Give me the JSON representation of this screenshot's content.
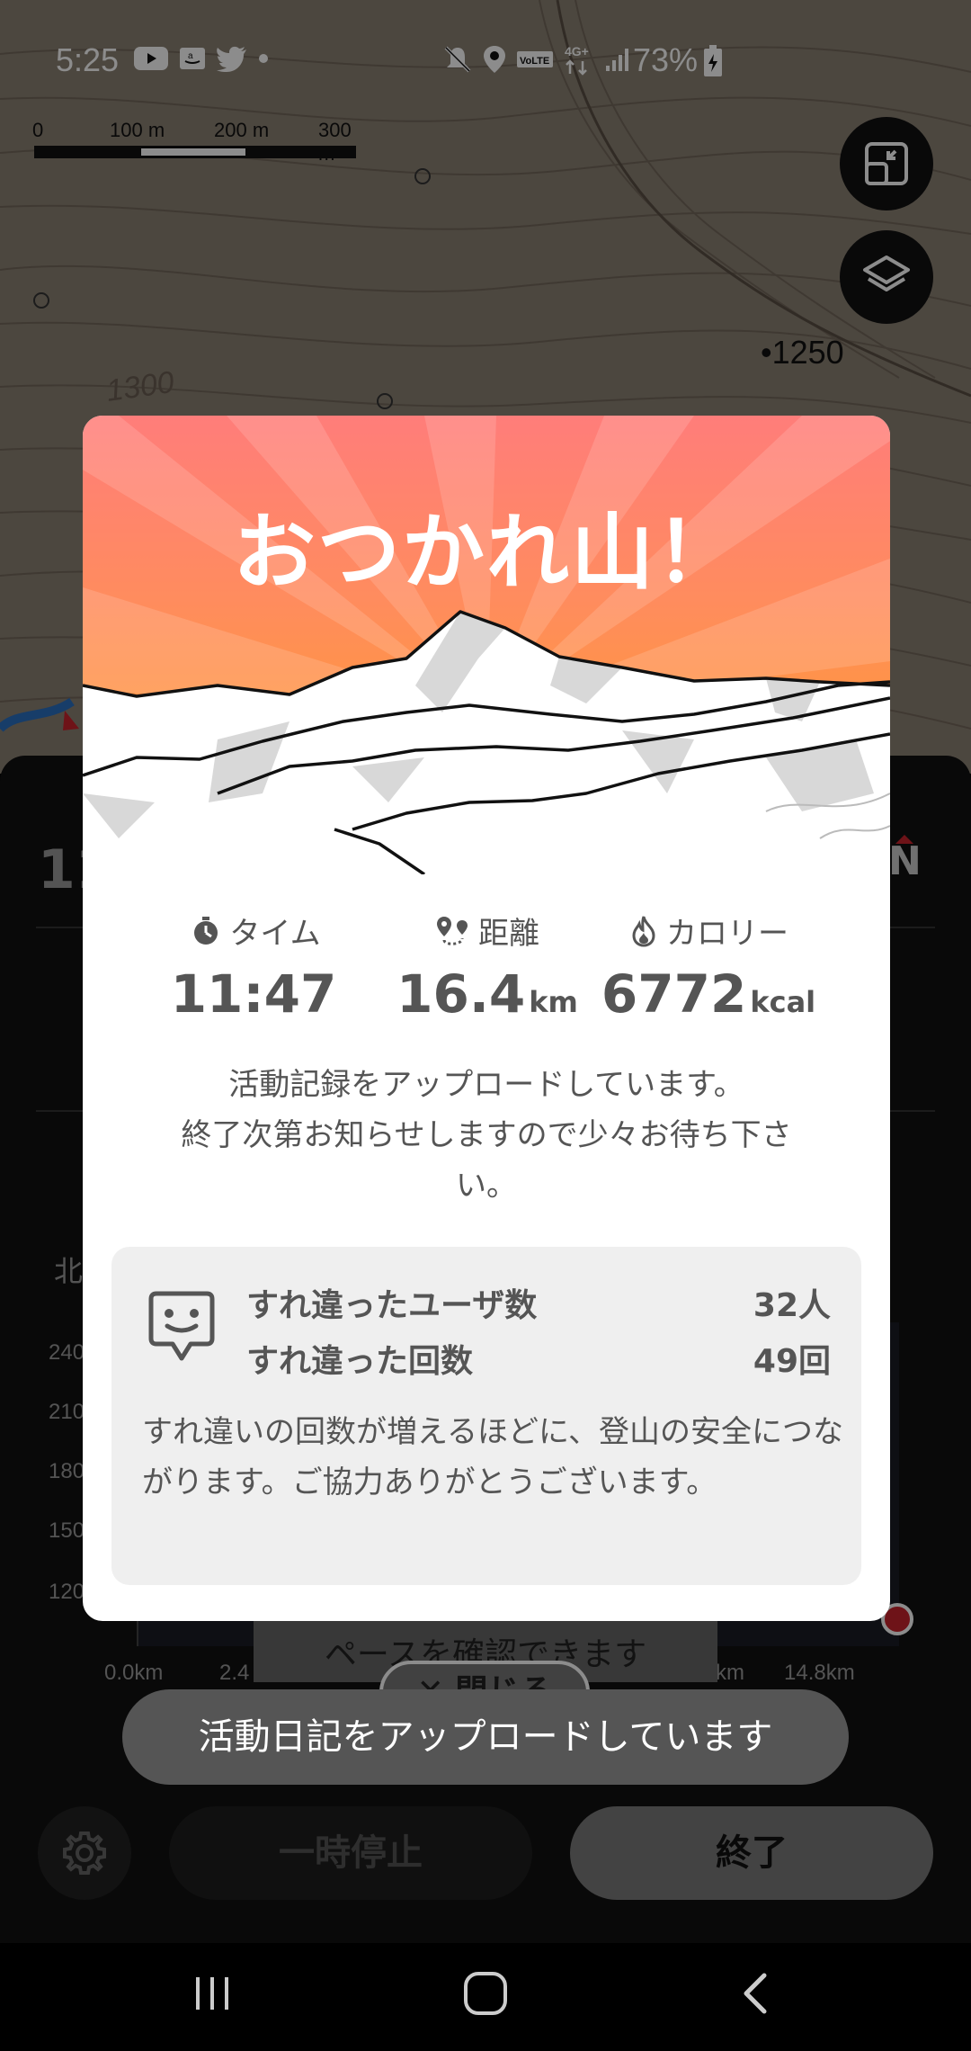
{
  "status_bar": {
    "time": "5:25",
    "battery": "73%",
    "icons_left": [
      "youtube-icon",
      "amazon-icon",
      "twitter-icon",
      "dot-icon"
    ],
    "icons_right": [
      "mute-icon",
      "location-icon",
      "volte-icon",
      "4g-icon",
      "signal-icon",
      "battery-icon"
    ],
    "network_label": "VoLTE",
    "network_type": "4G+"
  },
  "map": {
    "scale_labels": [
      "0",
      "100 m",
      "200 m",
      "300 m"
    ],
    "elevation_labels": [
      "1300",
      "•1250"
    ],
    "buttons": [
      "fullscreen-icon",
      "layers-icon"
    ]
  },
  "modal": {
    "title": "おつかれ山！",
    "stats": {
      "time": {
        "label": "タイム",
        "value": "11:47",
        "unit": ""
      },
      "distance": {
        "label": "距離",
        "value": "16.4",
        "unit": "km"
      },
      "calorie": {
        "label": "カロリー",
        "value": "6772",
        "unit": "kcal"
      }
    },
    "upload_message_line1": "活動記録をアップロードしています。",
    "upload_message_line2": "終了次第お知らせしますので少々お待ち下さ",
    "upload_message_line3": "い。",
    "passing": {
      "users_label": "すれ違ったユーザ数",
      "users_value": "32人",
      "count_label": "すれ違った回数",
      "count_value": "49回",
      "note": "すれ違いの回数が増えるほどに、登山の安全につながります。ご協力ありがとうございます。"
    }
  },
  "panel": {
    "stat_partial": "11",
    "compass_label": "N",
    "section_partial": "北",
    "y_ticks": [
      "240",
      "210",
      "180",
      "150",
      "120"
    ],
    "x_ticks": [
      "0.0km",
      "2.4",
      "km",
      "14.8km"
    ],
    "behind_toast_text": "ペースを確認できます",
    "behind_close_label": "✕ 閉じる",
    "pause_label": "一時停止",
    "finish_label": "終了"
  },
  "toast": {
    "text": "活動日記をアップロードしています"
  },
  "navbar": {
    "buttons": [
      "recent-apps-icon",
      "home-icon",
      "back-icon"
    ]
  },
  "colors": {
    "hero_top": "#ff7d7a",
    "hero_bottom": "#ffa437",
    "modal_bg": "#ffffff",
    "text_gray": "#555555",
    "box_bg": "#efefef",
    "end_dot": "#c9242c"
  }
}
